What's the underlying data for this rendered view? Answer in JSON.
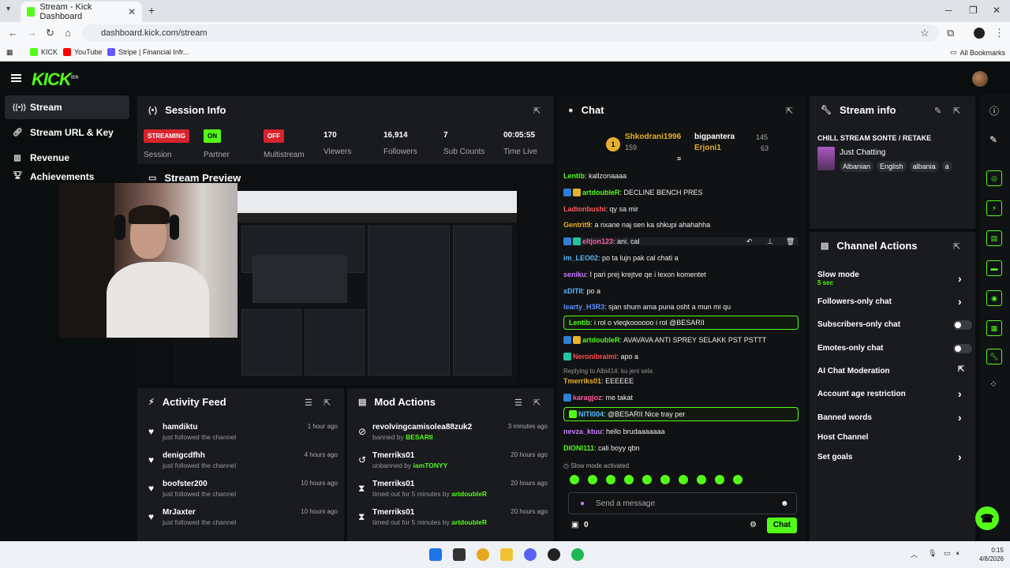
{
  "browser": {
    "tab_title": "Stream - Kick Dashboard",
    "url": "dashboard.kick.com/stream",
    "bookmarks": [
      {
        "label": "KICK",
        "color": "#53fc18"
      },
      {
        "label": "YouTube",
        "color": "#ff0000"
      },
      {
        "label": "Stripe | Financial Infr...",
        "color": "#635bff"
      }
    ],
    "all_bookmarks": "All Bookmarks"
  },
  "app": {
    "logo": "KICK",
    "logo_beta": "BETA",
    "accent": "#53fc18"
  },
  "sidebar": {
    "items": [
      {
        "label": "Stream",
        "icon": "broadcast-icon"
      },
      {
        "label": "Stream URL & Key",
        "icon": "link-icon"
      },
      {
        "label": "Revenue",
        "icon": "chart-icon"
      },
      {
        "label": "Achievements",
        "icon": "trophy-icon"
      }
    ]
  },
  "session": {
    "title": "Session Info",
    "streaming_badge": "STREAMING",
    "partner_badge": "ON",
    "multistream_badge": "OFF",
    "viewers": "170",
    "followers": "16,914",
    "sub_counts": "7",
    "time_live": "00:05:55",
    "labels": [
      "Session",
      "Partner",
      "Multistream",
      "Viewers",
      "Followers",
      "Sub Counts",
      "Time Live"
    ]
  },
  "preview": {
    "title": "Stream Preview"
  },
  "activity": {
    "title": "Activity Feed",
    "items": [
      {
        "name": "hamdiktu",
        "sub": "just followed the channel",
        "time": "1 hour ago"
      },
      {
        "name": "denigcdfhh",
        "sub": "just followed the channel",
        "time": "4 hours ago"
      },
      {
        "name": "boofster200",
        "sub": "just followed the channel",
        "time": "10 hours ago"
      },
      {
        "name": "MrJaxter",
        "sub": "just followed the channel",
        "time": "10 hours ago"
      }
    ]
  },
  "mod": {
    "title": "Mod Actions",
    "items": [
      {
        "name": "revolvingcamisolea88zuk2",
        "action": "banned by",
        "by": "BESARII",
        "time": "3 minutes ago",
        "icon": "ban-icon"
      },
      {
        "name": "Tmerriks01",
        "action": "unbanned by",
        "by": "iamTONYY",
        "time": "20 hours ago",
        "icon": "undo-icon"
      },
      {
        "name": "Tmerriks01",
        "action": "timed out for 5 minutes by",
        "by": "artdoubleR",
        "time": "20 hours ago",
        "icon": "hourglass-icon"
      },
      {
        "name": "Tmerriks01",
        "action": "timed out for 5 minutes by",
        "by": "artdoubleR",
        "time": "20 hours ago",
        "icon": "hourglass-icon"
      }
    ]
  },
  "chat": {
    "title": "Chat",
    "top1": {
      "rank": "1",
      "name": "Shkodrani1996",
      "count": "159"
    },
    "top2": {
      "name": "bigpantera",
      "count": "145"
    },
    "top3": {
      "name": "Erjoni1",
      "count": "63"
    },
    "messages": [
      {
        "user": "Lentib",
        "color": "#53fc18",
        "text": "kallzonaaaa"
      },
      {
        "user": "artdoubleR",
        "color": "#53fc18",
        "text": "DECLINE BENCH PRES"
      },
      {
        "user": "Ladionbushi",
        "color": "#ff5b5b",
        "text": "qy sa mir"
      },
      {
        "user": "Gentrit9",
        "color": "#e6b12d",
        "text": "a nxane naj sen ka shkupi ahahahha"
      },
      {
        "user": "eltjon123",
        "color": "#ff5b9f",
        "text": "ani. cal"
      },
      {
        "user": "im_LEO02",
        "color": "#5bb8ff",
        "text": "po ta lujn pak cal chati a"
      },
      {
        "user": "seniku",
        "color": "#c77dff",
        "text": "I pari prej krejtve qe i lexon komentet"
      },
      {
        "user": "xDITII",
        "color": "#5bb8ff",
        "text": "po a"
      },
      {
        "user": "learty_H3R3",
        "color": "#5b8dff",
        "text": "sjan shum ama puna osht a mun mi qu"
      },
      {
        "user": "Lentib",
        "color": "#53fc18",
        "text": "i rol o vleqkoooooo i rol @BESARII"
      },
      {
        "user": "artdoubleR",
        "color": "#53fc18",
        "text": "AVAVAVA ANTI SPREY SELAKK PST PSTTT"
      },
      {
        "user": "Neronibraimi",
        "color": "#ff4d4d",
        "text": "apo a"
      },
      {
        "user": "Tmerriks01",
        "color": "#e6b12d",
        "text": "EEEEEE"
      },
      {
        "user": "karagjoz",
        "color": "#ff5b9f",
        "text": "me takat"
      },
      {
        "user": "NITI004",
        "color": "#5bb8ff",
        "text": "@BESARII Nice tray per"
      },
      {
        "user": "nevza_ktuu",
        "color": "#c77dff",
        "text": "hello brudaaaaaaa"
      },
      {
        "user": "DIONI111",
        "color": "#53fc18",
        "text": "cali boyy qbn"
      }
    ],
    "reply_note": "Replying to Albi414: ku jeni sela",
    "slow_mode": "Slow mode activated",
    "placeholder": "Send a message",
    "points": "0",
    "send_label": "Chat"
  },
  "streaminfo": {
    "title": "Stream info",
    "stream_title": "CHILL STREAM SONTE / RETAKE",
    "category": "Just Chatting",
    "tags": [
      "Albanian",
      "English",
      "albania",
      "a"
    ]
  },
  "channel_actions": {
    "title": "Channel Actions",
    "rows": [
      {
        "label": "Slow mode",
        "sub": "5 sec",
        "control": "chevron"
      },
      {
        "label": "Followers-only chat",
        "control": "chevron"
      },
      {
        "label": "Subscribers-only chat",
        "control": "toggle"
      },
      {
        "label": "Emotes-only chat",
        "control": "toggle"
      },
      {
        "label": "AI Chat Moderation",
        "control": "external"
      },
      {
        "label": "Account age restriction",
        "control": "chevron"
      },
      {
        "label": "Banned words",
        "control": "chevron"
      },
      {
        "label": "Host Channel",
        "control": "none"
      },
      {
        "label": "Set goals",
        "control": "chevron"
      }
    ]
  },
  "taskbar": {
    "time": "0:15",
    "date": "4/8/2026"
  }
}
